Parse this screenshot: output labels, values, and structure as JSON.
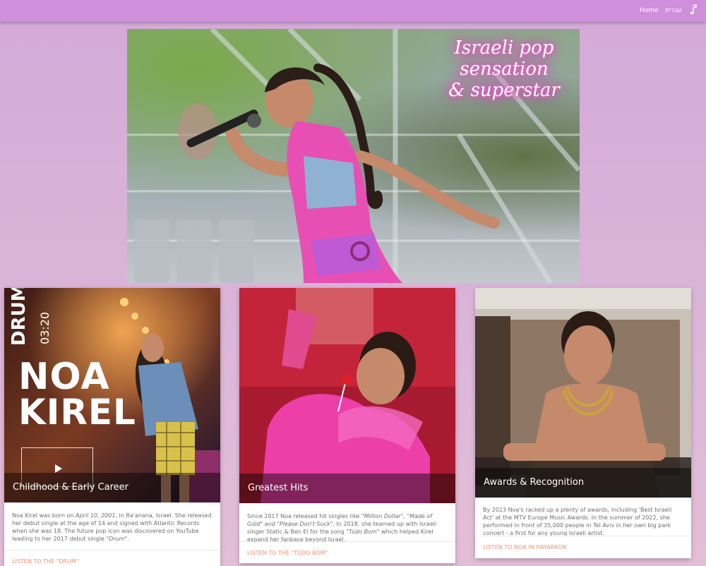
{
  "nav": {
    "home": "Home",
    "hebrew": "עברית",
    "music_icon": "music-note-icon"
  },
  "hero": {
    "lettering_line1": "Israeli pop sensation",
    "lettering_line2": "& superstar"
  },
  "cards": [
    {
      "poster_line1": "DRUM",
      "poster_line2": "03:20",
      "poster_line3": "NOA",
      "poster_line4": "KIREL",
      "play_icon": "play-icon",
      "caption": "Childhood & Early Career",
      "text": {
        "a": "Noa Kirel was born on ",
        "b": "April 10, 2001",
        "c": ", in Ra'anana, Israel. She released her debut single at the age of 14 and signed with Atlantic Records when she was 18. The future pop icon was discovered on YouTube leading to her 2017 debut single ",
        "d": "\"Drum\"",
        "e": "."
      },
      "link": "LISTEN TO THE \"DRUM\""
    },
    {
      "caption": "Greatest Hits",
      "text": {
        "a": "Since 2017 Noa released hit singles like ",
        "b": "\"Million Dollar\", \"Made of Gold\" and \"Please Don't Suck\"",
        "c": ". In 2018, she teamed up with Israeli singer Static & Ben El for the song ",
        "d": "\"Tudo Bom\"",
        "e": " which helped Kirel expand her fanbase beyond Israel."
      },
      "link": "LISTEN TO THE \"TUDO BOM\""
    },
    {
      "caption": "Awards & Recognition",
      "text": {
        "a": "By 2023 Noa's racked up a plenty of awards, including 'Best Israeli Act' at the MTV Europe Music Awards. In the summer of 2022, she performed in front of 35,000 people in Tel Aviv in her own big park concert - a first for any young Israeli artist."
      },
      "link": "LISTEN TO NOA IN HAYARKON"
    }
  ]
}
